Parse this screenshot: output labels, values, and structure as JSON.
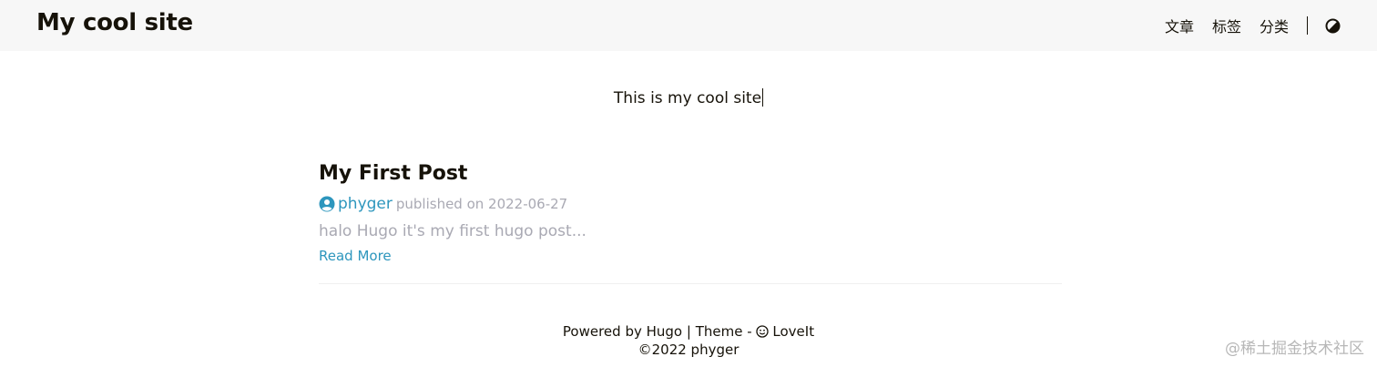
{
  "header": {
    "site_title": "My cool site",
    "nav": {
      "posts": "文章",
      "tags": "标签",
      "categories": "分类"
    },
    "theme_switch_icon": "half-circle-contrast-icon"
  },
  "subtitle": "This is my cool site",
  "post": {
    "title": "My First Post",
    "author_icon": "user-circle-icon",
    "author": "phyger",
    "published": "published on 2022-06-27",
    "summary": "halo Hugo it's my first hugo post...",
    "read_more": "Read More"
  },
  "footer": {
    "powered_prefix": "Powered by ",
    "hugo": "Hugo",
    "separator": " | ",
    "theme_prefix": "Theme - ",
    "theme_icon": "loveit-icon",
    "theme_name": "LoveIt",
    "copyright_symbol": "©",
    "copyright": "2022 phyger"
  },
  "watermark": "@稀土掘金技术社区",
  "colors": {
    "header_bg": "#f7f7f7",
    "link_accent": "#2d96bd",
    "muted_text": "#a9a9b3",
    "text": "#161209"
  }
}
